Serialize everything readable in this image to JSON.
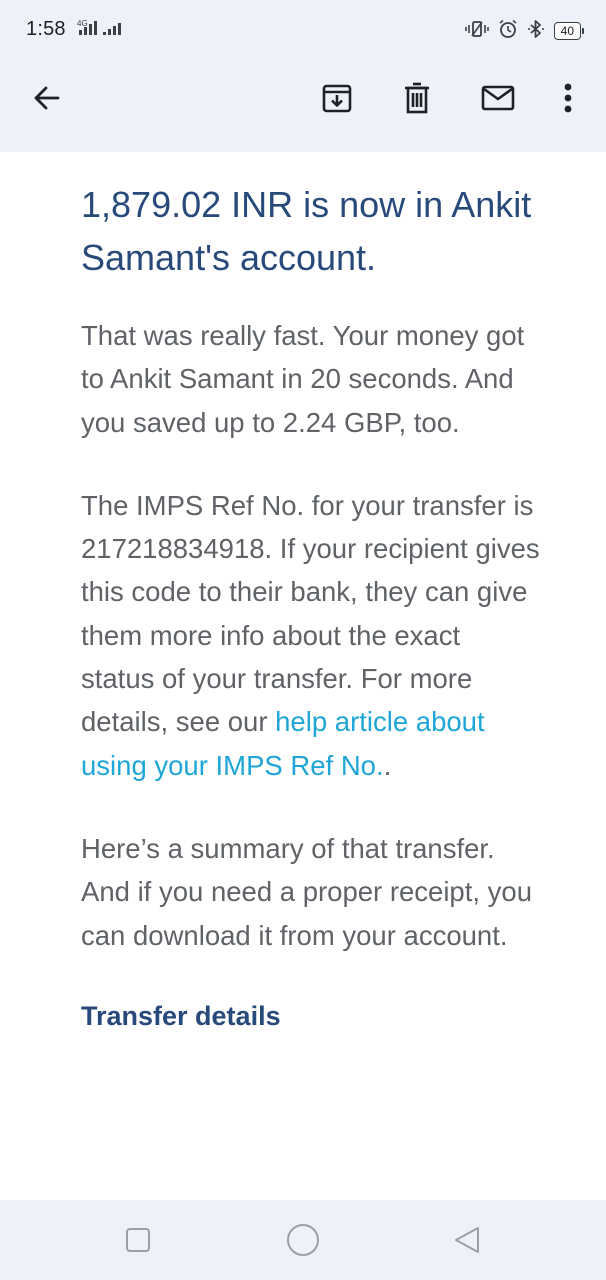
{
  "status_bar": {
    "time": "1:58",
    "network_label": "4G",
    "battery_level": "40",
    "icons": [
      "signal-icon",
      "vibrate-icon",
      "alarm-icon",
      "bluetooth-icon",
      "battery-icon"
    ]
  },
  "toolbar": {
    "back_icon": "arrow-back-icon",
    "archive_icon": "archive-icon",
    "delete_icon": "trash-icon",
    "mark_unread_icon": "mail-icon",
    "more_icon": "more-vert-icon"
  },
  "email": {
    "headline": "1,879.02 INR is now in Ankit Samant's account.",
    "para1": "That was really fast. Your money got to Ankit Samant in 20 seconds. And you saved up to 2.24 GBP, too.",
    "para2_text": "The IMPS Ref No. for your transfer is 217218834918. If your recipient gives this code to their bank, they can give them more info about the exact status of your transfer. For more details, see our ",
    "para2_link": "help article about using your IMPS Ref No.",
    "para2_end": ".",
    "para3": "Here’s a summary of that transfer. And if you need a proper receipt, you can download it from your account.",
    "section_heading": "Transfer details"
  },
  "nav_bar": {
    "recents_icon": "square-icon",
    "home_icon": "circle-icon",
    "back_icon": "triangle-back-icon"
  },
  "colors": {
    "header_bg": "#edf2fa",
    "heading": "#284a7a",
    "body_text": "#5f6368",
    "link": "#1fa6d7"
  }
}
